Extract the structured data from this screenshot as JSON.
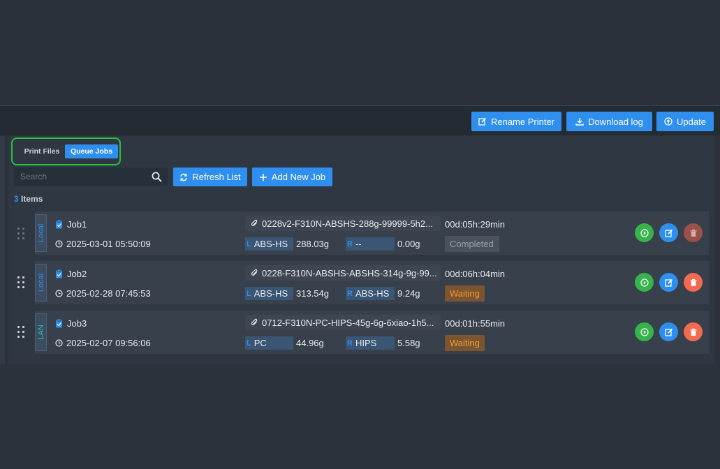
{
  "toolbar": {
    "rename_label": "Rename Printer",
    "download_label": "Download log",
    "update_label": "Update"
  },
  "tabs": {
    "print_files": "Print Files",
    "queue_jobs": "Queue Jobs",
    "active": "Queue Jobs"
  },
  "search": {
    "placeholder": "Search",
    "value": ""
  },
  "actions": {
    "refresh_label": "Refresh List",
    "add_label": "Add New Job"
  },
  "items": {
    "count": "3",
    "label": "Items"
  },
  "jobs": [
    {
      "source": "Local",
      "name": "Job1",
      "datetime": "2025-03-01 05:50:09",
      "file": "0228v2-F310N-ABSHS-288g-99999-5h2...",
      "duration": "00d:05h:29min",
      "left_side": "L",
      "left_material": "ABS-HS",
      "left_weight": "288.03g",
      "right_side": "R",
      "right_material": "--",
      "right_weight": "0.00g",
      "status": "Completed",
      "delete_enabled": false
    },
    {
      "source": "Local",
      "name": "Job2",
      "datetime": "2025-02-28 07:45:53",
      "file": "0228-F310N-ABSHS-ABSHS-314g-9g-99...",
      "duration": "00d:06h:04min",
      "left_side": "L",
      "left_material": "ABS-HS",
      "left_weight": "313.54g",
      "right_side": "R",
      "right_material": "ABS-HS",
      "right_weight": "9.24g",
      "status": "Waiting",
      "delete_enabled": true
    },
    {
      "source": "LAN",
      "name": "Job3",
      "datetime": "2025-02-07 09:56:06",
      "file": "0712-F310N-PC-HIPS-45g-6g-6xiao-1h5...",
      "duration": "00d:01h:55min",
      "left_side": "L",
      "left_material": "PC",
      "left_weight": "44.96g",
      "right_side": "R",
      "right_material": "HIPS",
      "right_weight": "5.58g",
      "status": "Waiting",
      "delete_enabled": true
    }
  ],
  "colors": {
    "accent": "#2f8fef",
    "highlight_border": "#27c23b",
    "play": "#36b34a",
    "delete": "#f26a4f",
    "waiting_text": "#f59a35"
  }
}
